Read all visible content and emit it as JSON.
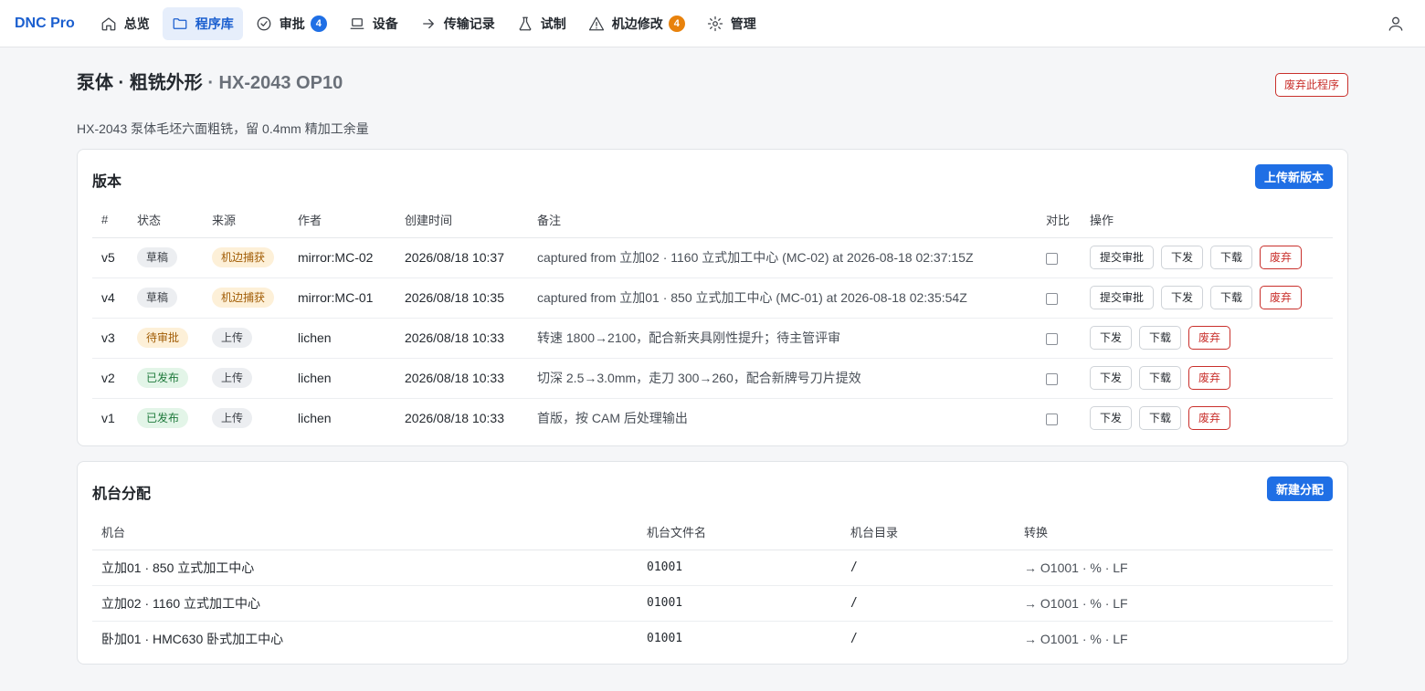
{
  "nav": {
    "brand": "DNC Pro",
    "items": [
      {
        "label": "总览"
      },
      {
        "label": "程序库"
      },
      {
        "label": "审批",
        "badge": "4"
      },
      {
        "label": "设备"
      },
      {
        "label": "传输记录"
      },
      {
        "label": "试制"
      },
      {
        "label": "机边修改",
        "badge": "4"
      },
      {
        "label": "管理"
      }
    ]
  },
  "program": {
    "title": "泵体 · 粗铣外形",
    "subtitle": " · HX-2043 OP10",
    "discard_label": "废弃此程序",
    "description": "HX-2043 泵体毛坯六面粗铣，留 0.4mm 精加工余量"
  },
  "versions": {
    "title": "版本",
    "upload_label": "上传新版本",
    "columns": [
      "#",
      "状态",
      "来源",
      "作者",
      "创建时间",
      "备注",
      "对比",
      "操作"
    ],
    "rows": [
      {
        "v": "v5",
        "status": "草稿",
        "source": "机边捕获",
        "author": "mirror:MC-02",
        "time": "2026/08/18 10:37",
        "note": "captured from 立加02 · 1160 立式加工中心 (MC-02) at 2026-08-18 02:37:15Z",
        "actions": [
          "提交审批",
          "下发",
          "下载",
          "废弃"
        ]
      },
      {
        "v": "v4",
        "status": "草稿",
        "source": "机边捕获",
        "author": "mirror:MC-01",
        "time": "2026/08/18 10:35",
        "note": "captured from 立加01 · 850 立式加工中心 (MC-01) at 2026-08-18 02:35:54Z",
        "actions": [
          "提交审批",
          "下发",
          "下载",
          "废弃"
        ]
      },
      {
        "v": "v3",
        "status": "待审批",
        "source": "上传",
        "author": "lichen",
        "time": "2026/08/18 10:33",
        "note": "转速 1800→2100，配合新夹具刚性提升；待主管评审",
        "actions": [
          "下发",
          "下载",
          "废弃"
        ]
      },
      {
        "v": "v2",
        "status": "已发布",
        "source": "上传",
        "author": "lichen",
        "time": "2026/08/18 10:33",
        "note": "切深 2.5→3.0mm，走刀 300→260，配合新牌号刀片提效",
        "actions": [
          "下发",
          "下载",
          "废弃"
        ]
      },
      {
        "v": "v1",
        "status": "已发布",
        "source": "上传",
        "author": "lichen",
        "time": "2026/08/18 10:33",
        "note": "首版，按 CAM 后处理输出",
        "actions": [
          "下发",
          "下载",
          "废弃"
        ]
      }
    ]
  },
  "assignments": {
    "title": "机台分配",
    "new_label": "新建分配",
    "columns": [
      "机台",
      "机台文件名",
      "机台目录",
      "转换"
    ],
    "rows": [
      {
        "machine": "立加01 · 850 立式加工中心",
        "file": "01001",
        "dir": "/",
        "convert": "→ O1001 · % · LF"
      },
      {
        "machine": "立加02 · 1160 立式加工中心",
        "file": "01001",
        "dir": "/",
        "convert": "→ O1001 · % · LF"
      },
      {
        "machine": "卧加01 · HMC630 卧式加工中心",
        "file": "01001",
        "dir": "/",
        "convert": "→ O1001 · % · LF"
      }
    ]
  }
}
